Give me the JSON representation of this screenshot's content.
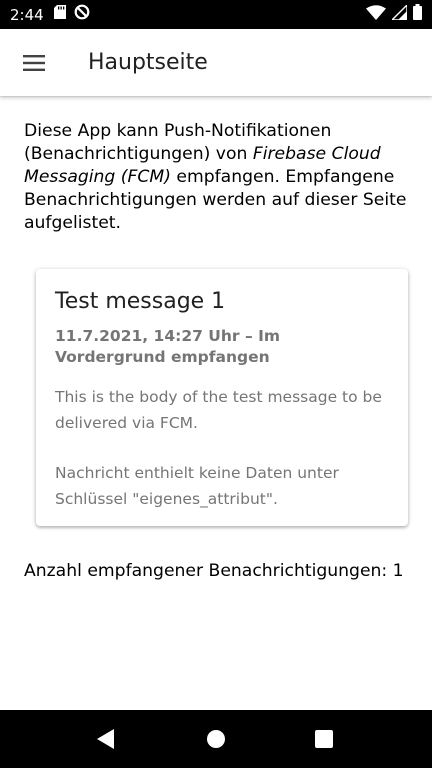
{
  "status_bar": {
    "time": "2:44",
    "left_icons": [
      "sd-card-icon",
      "do-not-disturb-icon"
    ],
    "right_icons": [
      "wifi-icon",
      "signal-icon",
      "battery-icon"
    ]
  },
  "app_bar": {
    "menu_icon": "menu-icon",
    "title": "Hauptseite"
  },
  "intro": {
    "part1": "Diese App kann Push-Notifikationen (Benachrichtigungen) von ",
    "emphasis": "Firebase Cloud Messaging (FCM)",
    "part2": " empfangen. Empfangene Benachrichtigungen werden auf dieser Seite aufgelistet."
  },
  "messages": [
    {
      "title": "Test message 1",
      "subtitle": "11.7.2021, 14:27 Uhr – Im Vordergrund empfangen",
      "body": "This is the body of the test message to be delivered via FCM.",
      "data_note": "Nachricht enthielt keine Daten unter Schlüssel \"eigenes_attribut\"."
    }
  ],
  "count_text": "Anzahl empfangener Benachrichtigungen: 1",
  "nav_bar": {
    "icons": [
      "back-icon",
      "home-icon",
      "recents-icon"
    ]
  }
}
